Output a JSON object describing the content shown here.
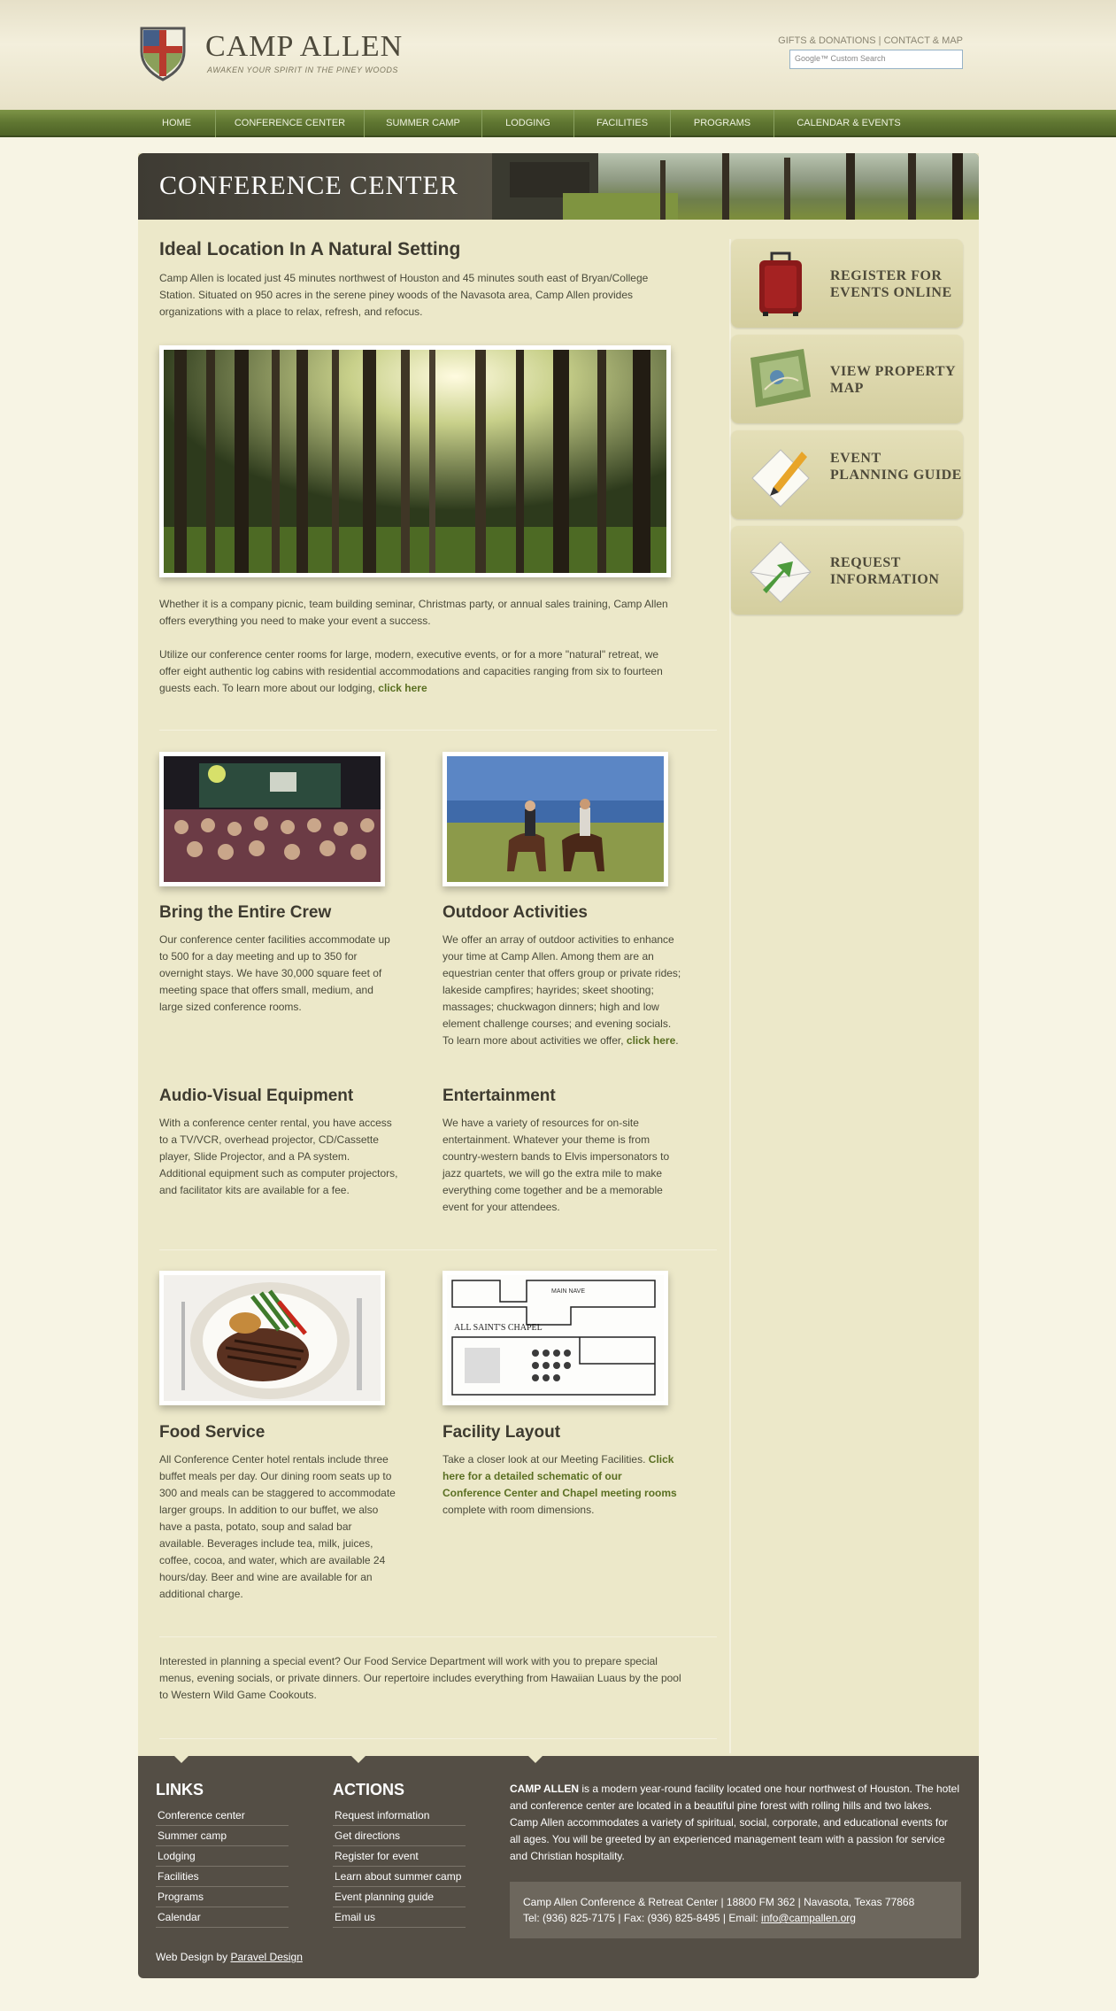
{
  "header": {
    "logo_title": "CAMP ALLEN",
    "logo_tagline": "AWAKEN YOUR SPIRIT IN THE PINEY WOODS",
    "top_link_1": "GIFTS & DONATIONS",
    "top_link_sep": "|",
    "top_link_2": "CONTACT & MAP",
    "search_placeholder": "Google™ Custom Search"
  },
  "nav": {
    "items": [
      "HOME",
      "CONFERENCE CENTER",
      "SUMMER CAMP",
      "LODGING",
      "FACILITIES",
      "PROGRAMS",
      "CALENDAR & EVENTS"
    ]
  },
  "banner": {
    "title": "CONFERENCE CENTER"
  },
  "intro": {
    "heading": "Ideal Location In A Natural Setting",
    "paragraph": "Camp Allen is located just 45 minutes northwest of Houston and 45 minutes south east of Bryan/College Station. Situated on 950 acres in the serene piney woods of the Navasota area, Camp Allen provides organizations with a place to relax, refresh, and refocus.",
    "paragraph2": "Whether it is a company picnic, team building seminar, Christmas party, or annual sales training, Camp Allen offers everything you need to make your event a success.",
    "paragraph3": "Utilize our conference center rooms for large, modern, executive events, or for a more \"natural\" retreat, we offer eight authentic log cabins with residential accommodations and capacities ranging from six to fourteen guests each. To learn more about our lodging,",
    "paragraph3_link": "click here"
  },
  "sections": {
    "crew": {
      "heading": "Bring the Entire Crew",
      "text": "Our conference center facilities accommodate up to 500 for a day meeting and up to 350 for overnight stays. We have 30,000 square feet of meeting space that offers small, medium, and large sized conference rooms."
    },
    "outdoor": {
      "heading": "Outdoor Activities",
      "text": "We offer an array of outdoor activities to enhance your time at Camp Allen. Among them are an equestrian center that offers group or private rides; lakeside campfires; hayrides; skeet shooting; massages; chuckwagon dinners; high and low element challenge courses; and evening socials. To learn more about activities we offer,",
      "link": "click here",
      "suffix": "."
    },
    "av": {
      "heading": "Audio-Visual Equipment",
      "text": "With a conference center rental, you have access to a TV/VCR, overhead projector, CD/Cassette player, Slide Projector, and a PA system. Additional equipment such as computer projectors, and facilitator kits are available for a fee."
    },
    "entertainment": {
      "heading": "Entertainment",
      "text": "We have a variety of resources for on-site entertainment. Whatever your theme is from country-western bands to Elvis impersonators to jazz quartets, we will go the extra mile to make everything come together and be a memorable event for your attendees."
    },
    "food": {
      "heading": "Food Service",
      "text": "All Conference Center hotel rentals include three buffet meals per day. Our dining room seats up to 300 and meals can be staggered to accommodate larger groups. In addition to our buffet, we also have a pasta, potato, soup and salad bar available. Beverages include tea, milk, juices, coffee, cocoa, and water, which are available 24 hours/day. Beer and wine are available for an additional charge."
    },
    "layout": {
      "heading": "Facility Layout",
      "text": "Take a closer look at our Meeting Facilities.",
      "link": "Click here for a detailed schematic of our Conference Center and Chapel meeting rooms",
      "suffix": "complete with room dimensions."
    },
    "special": {
      "text": "Interested in planning a special event? Our Food Service Department will work with you to prepare special menus, evening socials, or private dinners. Our repertoire includes everything from Hawaiian Luaus by the pool to Western Wild Game Cookouts."
    },
    "chapel_map_label": "ALL SAINT'S CHAPEL",
    "chapel_map_nave": "MAIN NAVE"
  },
  "sidebar": {
    "register": "REGISTER FOR EVENTS ONLINE",
    "map": "VIEW PROPERTY MAP",
    "guide": "EVENT PLANNING GUIDE",
    "request": "REQUEST INFORMATION"
  },
  "footer": {
    "links_heading": "LINKS",
    "links": [
      "Conference center",
      "Summer camp",
      "Lodging",
      "Facilities",
      "Programs",
      "Calendar"
    ],
    "actions_heading": "ACTIONS",
    "actions": [
      "Request information",
      "Get directions",
      "Register for event",
      "Learn about summer camp",
      "Event planning guide",
      "Email us"
    ],
    "about_bold": "CAMP ALLEN",
    "about_text": " is a modern year-round facility located one hour northwest of Houston. The hotel and conference center are located in a beautiful pine forest with rolling hills and two lakes. Camp Allen accommodates a variety of spiritual, social, corporate, and educational events for all ages. You will be greeted by an experienced management team with a passion for service and Christian hospitality.",
    "address": "Camp Allen Conference & Retreat Center | 18800 FM 362 | Navasota, Texas 77868",
    "phone": "Tel: (936) 825-7175 | Fax: (936) 825-8495 | Email: ",
    "email": "info@campallen.org",
    "credit_prefix": "Web Design by ",
    "credit_link": "Paravel Design"
  }
}
